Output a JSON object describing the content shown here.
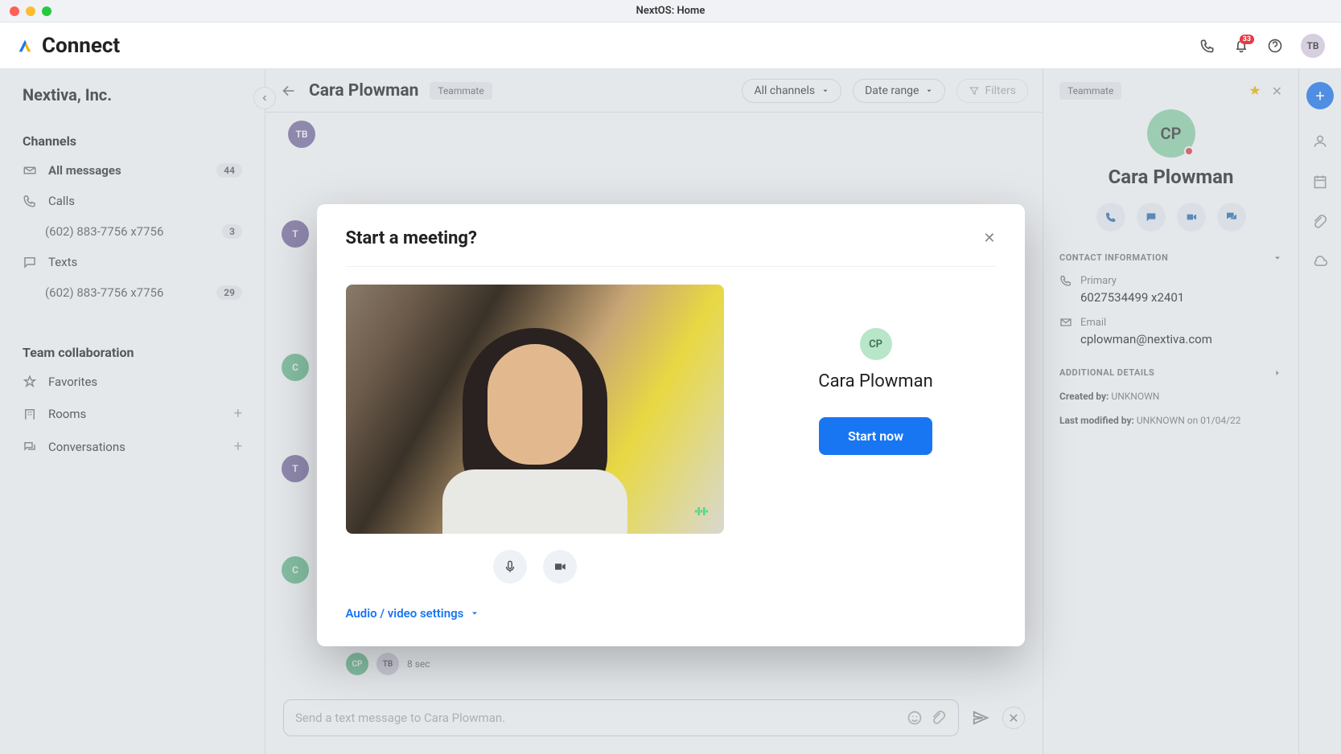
{
  "window": {
    "title": "NextOS: Home"
  },
  "header": {
    "app_name": "Connect",
    "notification_count": "33",
    "user_initials": "TB"
  },
  "sidebar": {
    "org": "Nextiva, Inc.",
    "section_channels": "Channels",
    "all_messages": {
      "label": "All messages",
      "count": "44"
    },
    "calls": {
      "label": "Calls"
    },
    "calls_number": {
      "label": "(602) 883-7756 x7756",
      "count": "3"
    },
    "texts": {
      "label": "Texts"
    },
    "texts_number": {
      "label": "(602) 883-7756 x7756",
      "count": "29"
    },
    "section_team": "Team collaboration",
    "favorites": {
      "label": "Favorites"
    },
    "rooms": {
      "label": "Rooms"
    },
    "conversations": {
      "label": "Conversations"
    }
  },
  "conversation": {
    "name": "Cara Plowman",
    "tag": "Teammate",
    "channel_filter": "All channels",
    "date_filter": "Date range",
    "filters_label": "Filters",
    "call_duration": "8 sec",
    "input_placeholder": "Send a text message to Cara Plowman.",
    "avatars": {
      "tb": "TB",
      "cp": "CP"
    }
  },
  "details": {
    "tag": "Teammate",
    "initials": "CP",
    "name": "Cara Plowman",
    "contact_info_title": "CONTACT INFORMATION",
    "primary_label": "Primary",
    "primary_value": "6027534499 x2401",
    "email_label": "Email",
    "email_value": "cplowman@nextiva.com",
    "additional_title": "ADDITIONAL DETAILS",
    "created_by_label": "Created by:",
    "created_by_value": "UNKNOWN",
    "modified_label": "Last modified by:",
    "modified_value": "UNKNOWN on 01/04/22"
  },
  "modal": {
    "title": "Start a meeting?",
    "invitee_initials": "CP",
    "invitee_name": "Cara Plowman",
    "start_label": "Start now",
    "av_settings_label": "Audio / video settings"
  }
}
